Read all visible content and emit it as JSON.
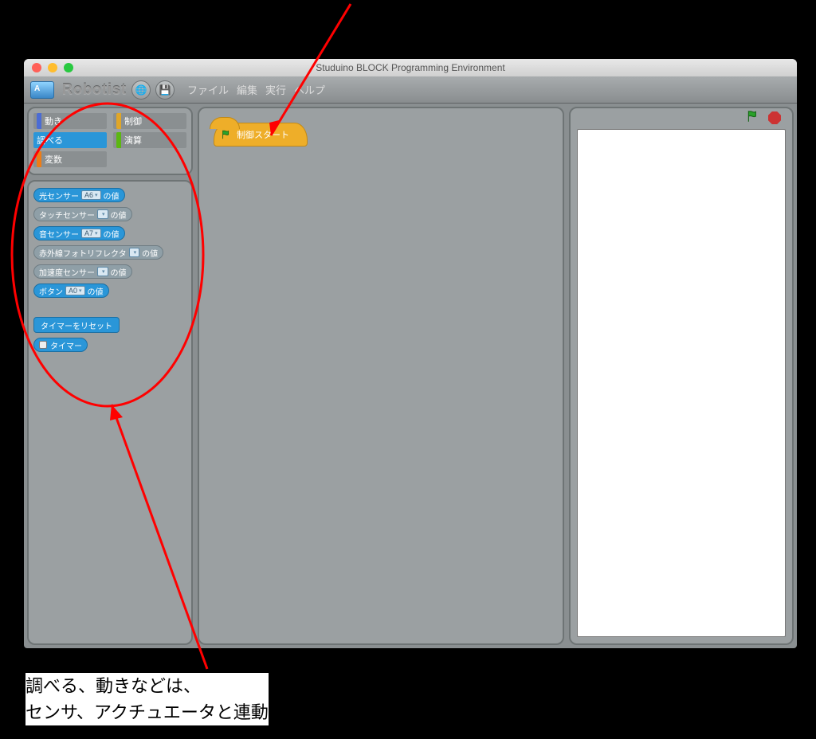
{
  "window": {
    "title": "Studuino BLOCK Programming Environment",
    "brand": "Robotist"
  },
  "menu": {
    "file": "ファイル",
    "edit": "編集",
    "run": "実行",
    "help": "ヘルプ"
  },
  "categories": {
    "motion": "動き",
    "control": "制御",
    "sensing": "調べる",
    "operators": "演算",
    "variables": "変数"
  },
  "blocks": {
    "light_label_pre": "光センサー",
    "light_port": "A6",
    "light_label_post": "の値",
    "touch_label_pre": "タッチセンサー",
    "touch_label_post": "の値",
    "sound_label_pre": "音センサー",
    "sound_port": "A7",
    "sound_label_post": "の値",
    "ir_label_pre": "赤外線フォトリフレクタ",
    "ir_label_post": "の値",
    "accel_label_pre": "加速度センサー",
    "accel_label_post": "の値",
    "button_label_pre": "ボタン",
    "button_port": "A0",
    "button_label_post": "の値",
    "timer_reset": "タイマーをリセット",
    "timer": "タイマー"
  },
  "script": {
    "hat": "制御スタート"
  },
  "annotation": {
    "line1": "調べる、動きなどは、",
    "line2": "センサ、アクチュエータと連動"
  }
}
